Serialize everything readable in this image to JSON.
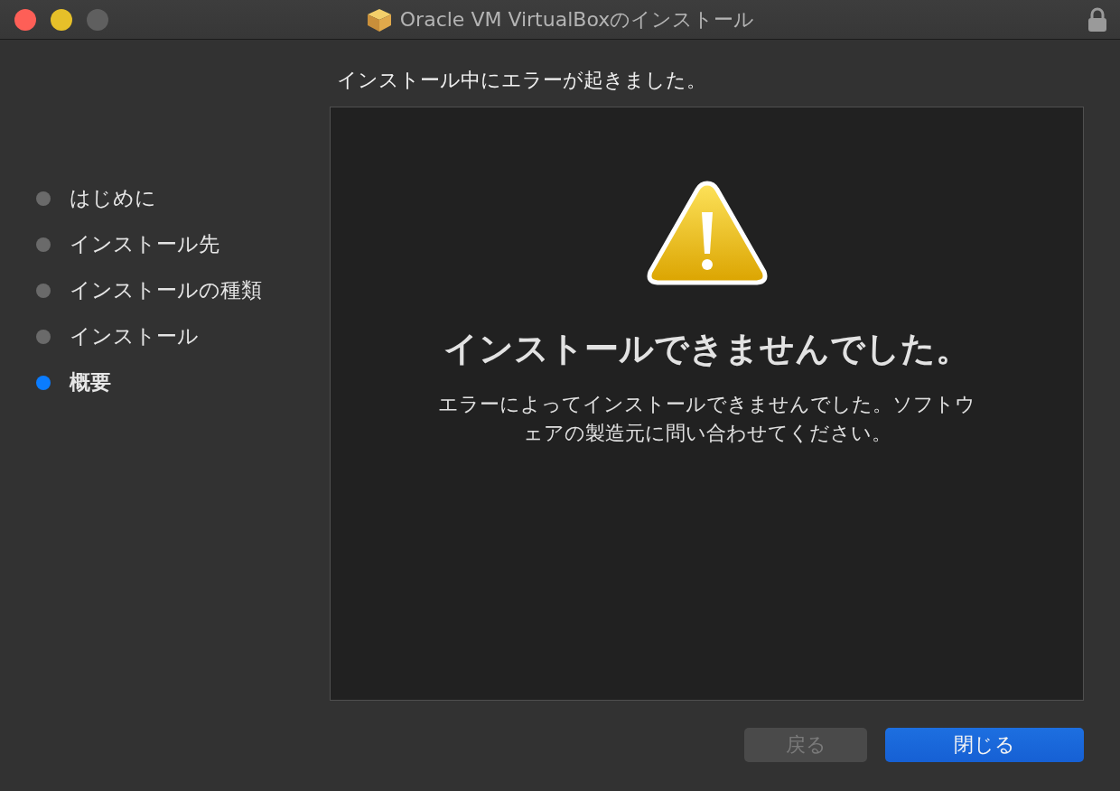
{
  "window": {
    "title": "Oracle VM VirtualBoxのインストール",
    "controls": [
      {
        "kind": "close",
        "disabled": false
      },
      {
        "kind": "minimize",
        "disabled": false
      },
      {
        "kind": "zoom",
        "disabled": true
      }
    ]
  },
  "steps": [
    {
      "label": "はじめに",
      "selected": false
    },
    {
      "label": "インストール先",
      "selected": false
    },
    {
      "label": "インストールの種類",
      "selected": false
    },
    {
      "label": "インストール",
      "selected": false
    },
    {
      "label": "概要",
      "selected": true
    }
  ],
  "heading": "インストール中にエラーが起きました。",
  "panel": {
    "title": "インストールできませんでした。",
    "message": "エラーによってインストールできませんでした。ソフトウェアの製造元に問い合わせてください。"
  },
  "buttons": [
    {
      "label": "戻る",
      "kind": "secondary",
      "disabled": true
    },
    {
      "label": "閉じる",
      "kind": "primary",
      "disabled": false
    }
  ]
}
